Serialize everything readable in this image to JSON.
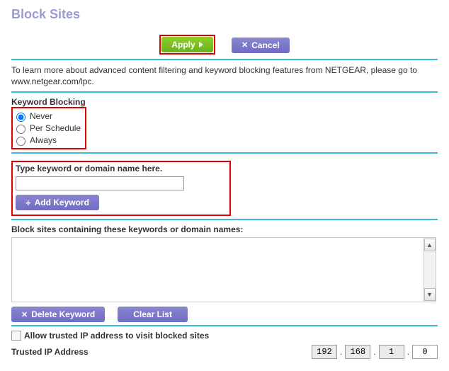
{
  "title": "Block Sites",
  "top": {
    "apply": "Apply",
    "cancel": "Cancel"
  },
  "info": {
    "text": "To learn more about advanced content filtering and keyword blocking features from NETGEAR, please go to www.netgear.com/lpc."
  },
  "keywordBlocking": {
    "label": "Keyword Blocking",
    "options": {
      "never": "Never",
      "perSchedule": "Per Schedule",
      "always": "Always"
    },
    "selected": "never"
  },
  "keywordEntry": {
    "label": "Type keyword or domain name here.",
    "value": "",
    "addBtn": "Add Keyword"
  },
  "blockList": {
    "label": "Block sites containing these keywords or domain names:",
    "deleteBtn": "Delete Keyword",
    "clearBtn": "Clear List"
  },
  "trusted": {
    "checkboxLabel": "Allow trusted IP address to visit blocked sites",
    "checked": false,
    "ipLabel": "Trusted IP Address",
    "octets": [
      "192",
      "168",
      "1",
      "0"
    ]
  }
}
